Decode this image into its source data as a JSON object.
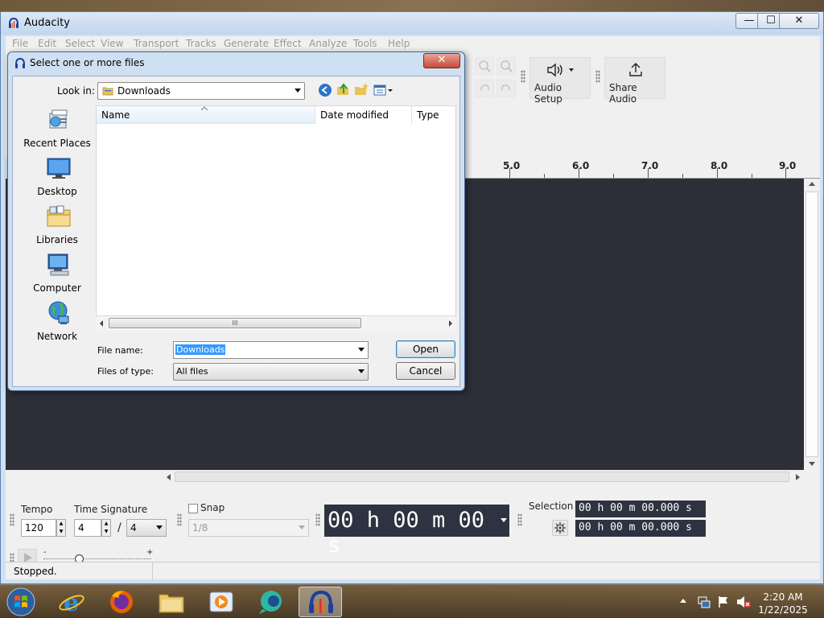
{
  "window": {
    "title": "Audacity",
    "min_glyph": "—",
    "max_glyph": "☐",
    "close_glyph": "✕"
  },
  "menu": [
    "File",
    "Edit",
    "Select",
    "View",
    "Transport",
    "Tracks",
    "Generate",
    "Effect",
    "Analyze",
    "Tools",
    "Help"
  ],
  "toolbar": {
    "audio_setup": "Audio Setup",
    "share_audio": "Share Audio"
  },
  "ruler": {
    "ticks": [
      "5.0",
      "6.0",
      "7.0",
      "8.0",
      "9.0"
    ]
  },
  "dialog": {
    "title": "Select one or more files",
    "close_glyph": "✕",
    "look_in_label": "Look in:",
    "look_in_value": "Downloads",
    "places": [
      "Recent Places",
      "Desktop",
      "Libraries",
      "Computer",
      "Network"
    ],
    "columns": [
      "Name",
      "Date modified",
      "Type"
    ],
    "file_name_label": "File name:",
    "file_name_value": "Downloads",
    "files_of_type_label": "Files of type:",
    "files_of_type_value": "All files",
    "open_label": "Open",
    "cancel_label": "Cancel",
    "scroll_grip": "III"
  },
  "bottom": {
    "tempo_label": "Tempo",
    "tempo_value": "120",
    "time_sig_label": "Time Signature",
    "time_sig_top": "4",
    "time_sig_sep": "/",
    "time_sig_bottom": "4",
    "snap_label": "Snap",
    "snap_value": "1/8",
    "time_display": "00 h 00 m 00 s",
    "selection_label": "Selection",
    "selection_start": "00 h 00 m 00.000 s",
    "selection_end": "00 h 00 m 00.000 s",
    "slider_minus": "-",
    "slider_plus": "+"
  },
  "status": {
    "text": "Stopped."
  },
  "taskbar": {
    "time": "2:20 AM",
    "date": "1/22/2025"
  }
}
